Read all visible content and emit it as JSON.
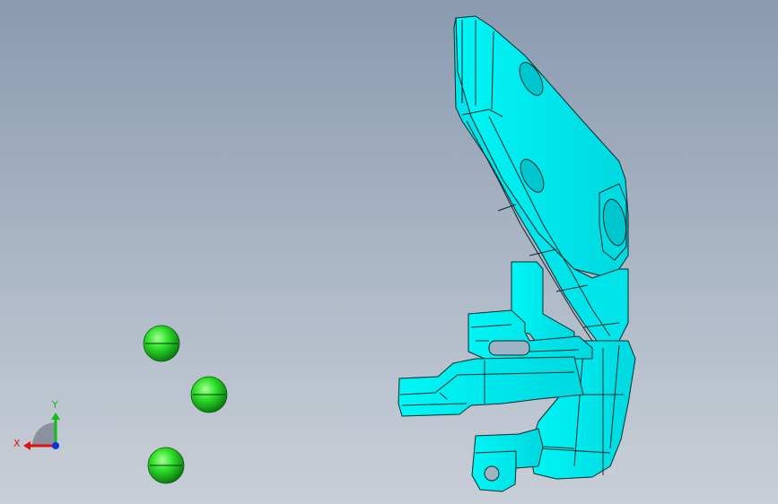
{
  "viewport": {
    "background_top": "#8a9ab0",
    "background_bottom": "#c9cfd7"
  },
  "model": {
    "fill_color": "#00f0f0",
    "edge_color": "#0a2a2a",
    "shade_color": "#00c8d2"
  },
  "markers": {
    "color": "#22d622",
    "count": 3
  },
  "triad": {
    "x_label": "X",
    "y_label": "Y",
    "x_color": "#e01010",
    "y_color": "#10c010",
    "z_color": "#1030e0"
  }
}
